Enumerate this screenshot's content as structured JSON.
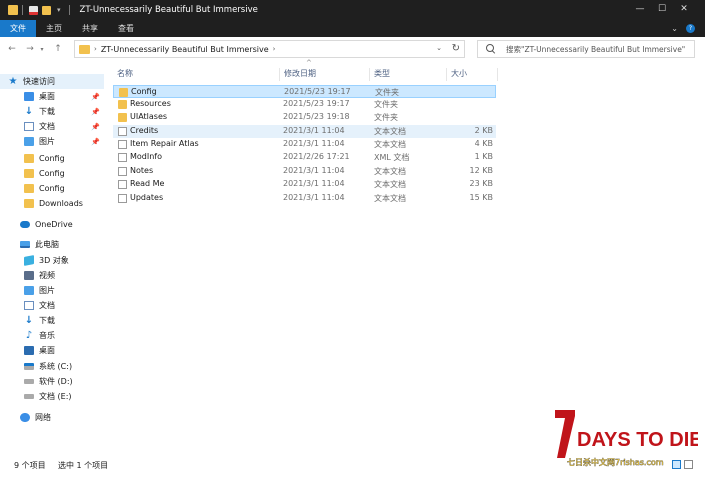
{
  "window": {
    "title": "ZT-Unnecessarily Beautiful But Immersive"
  },
  "ribbon": {
    "tabs": [
      "文件",
      "主页",
      "共享",
      "查看"
    ]
  },
  "address": {
    "path_label": "ZT-Unnecessarily Beautiful But Immersive"
  },
  "search": {
    "placeholder": "搜索\"ZT-Unnecessarily Beautiful But Immersive\""
  },
  "sidebar": {
    "quick_access": "快速访问",
    "quick_items": [
      "桌面",
      "下载",
      "文档",
      "图片",
      "Config",
      "Config",
      "Config",
      "Downloads"
    ],
    "onedrive": "OneDrive",
    "this_pc": "此电脑",
    "pc_items": [
      "3D 对象",
      "视频",
      "图片",
      "文档",
      "下载",
      "音乐",
      "桌面",
      "系统 (C:)",
      "软件 (D:)",
      "文档 (E:)"
    ],
    "network": "网络"
  },
  "columns": {
    "name": "名称",
    "modified": "修改日期",
    "type": "类型",
    "size": "大小"
  },
  "files": [
    {
      "name": "Config",
      "modified": "2021/5/23 19:17",
      "type": "文件夹",
      "size": "",
      "kind": "folder"
    },
    {
      "name": "Resources",
      "modified": "2021/5/23 19:17",
      "type": "文件夹",
      "size": "",
      "kind": "folder"
    },
    {
      "name": "UIAtlases",
      "modified": "2021/5/23 19:18",
      "type": "文件夹",
      "size": "",
      "kind": "folder"
    },
    {
      "name": "Credits",
      "modified": "2021/3/1 11:04",
      "type": "文本文档",
      "size": "2 KB",
      "kind": "doc"
    },
    {
      "name": "Item Repair Atlas",
      "modified": "2021/3/1 11:04",
      "type": "文本文档",
      "size": "4 KB",
      "kind": "doc"
    },
    {
      "name": "ModInfo",
      "modified": "2021/2/26 17:21",
      "type": "XML 文档",
      "size": "1 KB",
      "kind": "doc"
    },
    {
      "name": "Notes",
      "modified": "2021/3/1 11:04",
      "type": "文本文档",
      "size": "12 KB",
      "kind": "doc"
    },
    {
      "name": "Read Me",
      "modified": "2021/3/1 11:04",
      "type": "文本文档",
      "size": "23 KB",
      "kind": "doc"
    },
    {
      "name": "Updates",
      "modified": "2021/3/1 11:04",
      "type": "文本文档",
      "size": "15 KB",
      "kind": "doc"
    }
  ],
  "status": {
    "count": "9 个项目",
    "selected": "选中 1 个项目"
  },
  "watermark": {
    "logo": "7 DAYS TO DIE",
    "site": "七日杀中文网7rishas.com"
  },
  "colors": {
    "accent": "#1979ca",
    "folder": "#f2c14e",
    "selected": "#cce8ff"
  }
}
